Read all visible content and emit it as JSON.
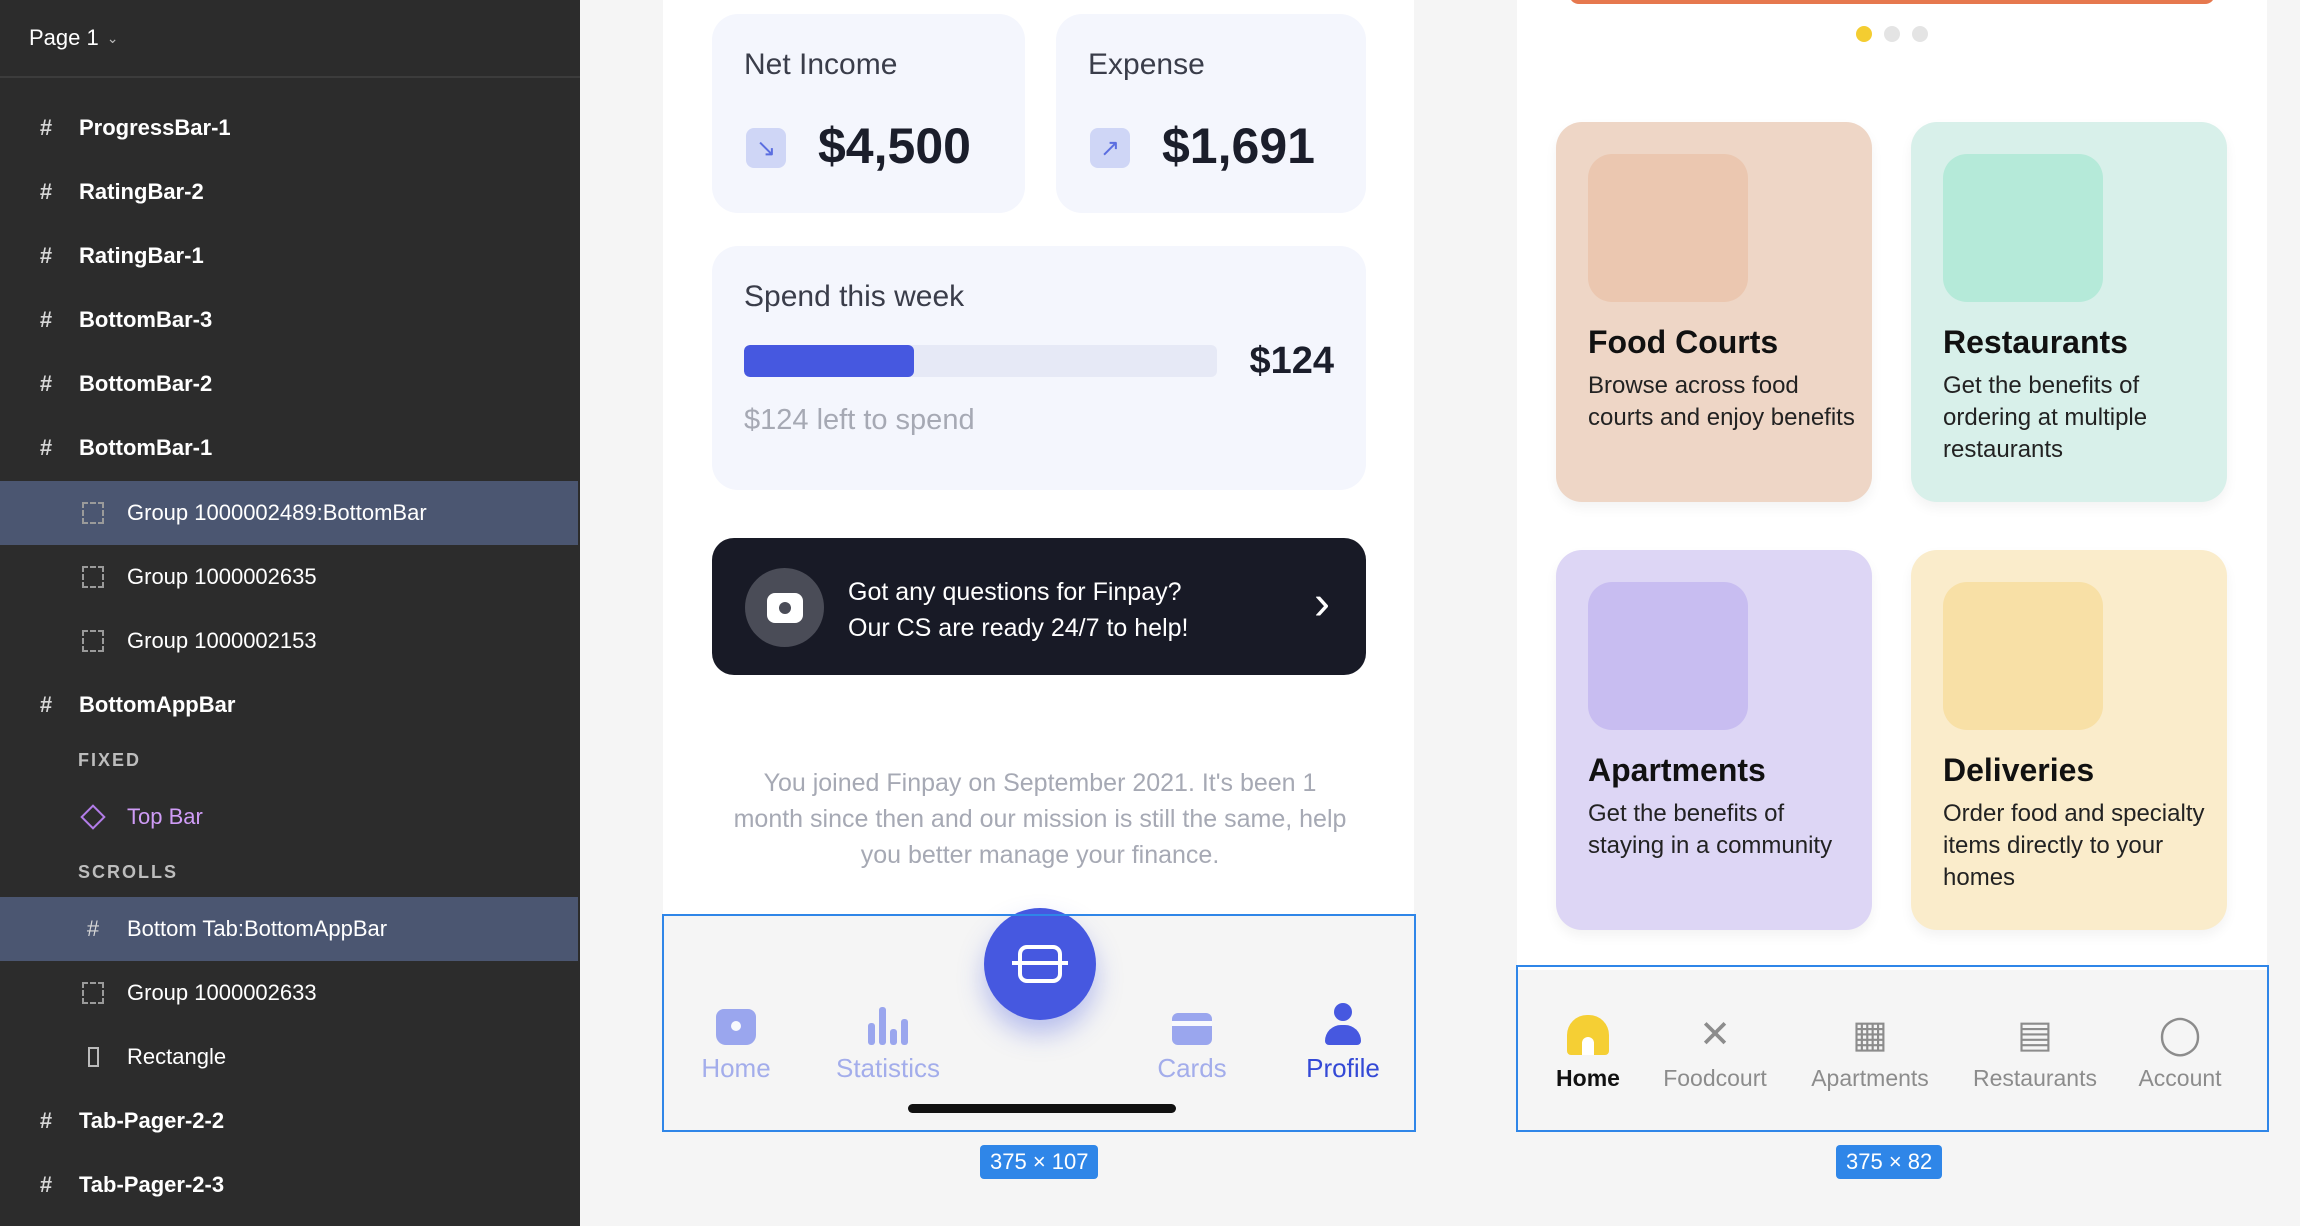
{
  "layers_panel": {
    "page_name": "Page 1",
    "fixed_label": "FIXED",
    "scrolls_label": "SCROLLS",
    "items": [
      {
        "label": "ProgressBar-1"
      },
      {
        "label": "RatingBar-2"
      },
      {
        "label": "RatingBar-1"
      },
      {
        "label": "BottomBar-3"
      },
      {
        "label": "BottomBar-2"
      },
      {
        "label": "BottomBar-1"
      },
      {
        "label": "Group 1000002489:BottomBar"
      },
      {
        "label": "Group 1000002635"
      },
      {
        "label": "Group 1000002153"
      },
      {
        "label": "BottomAppBar"
      },
      {
        "label": "Top Bar"
      },
      {
        "label": "Bottom Tab:BottomAppBar"
      },
      {
        "label": "Group 1000002633"
      },
      {
        "label": "Rectangle"
      },
      {
        "label": "Tab-Pager-2-2"
      },
      {
        "label": "Tab-Pager-2-3"
      }
    ]
  },
  "finpay": {
    "net_income": {
      "label": "Net Income",
      "amount": "$4,500"
    },
    "expense": {
      "label": "Expense",
      "amount": "$1,691"
    },
    "spend": {
      "title": "Spend this week",
      "amount": "$124",
      "left_text": "$124 left to spend",
      "progress_percent": 36
    },
    "cs_banner": {
      "line1": "Got any questions for Finpay?",
      "line2": "Our CS are ready 24/7 to help!"
    },
    "joined_text": "You joined Finpay on September 2021. It's been 1 month since then and our mission is still the same, help you better manage your finance.",
    "tabs": [
      {
        "label": "Home",
        "icon": "home-icon"
      },
      {
        "label": "Statistics",
        "icon": "statistics-icon"
      },
      {
        "label": "Cards",
        "icon": "card-icon"
      },
      {
        "label": "Profile",
        "icon": "profile-icon",
        "active": true
      }
    ],
    "size_tag": "375 × 107"
  },
  "food_app": {
    "tiles": [
      {
        "title": "Food Courts",
        "desc": "Browse across food courts and enjoy benefits",
        "bg": "#eed6c6",
        "accent": "#ebc7b0"
      },
      {
        "title": "Restaurants",
        "desc": "Get the benefits of ordering at multiple restaurants",
        "bg": "#d8f0ea",
        "accent": "#b5ead9"
      },
      {
        "title": "Apartments",
        "desc": "Get the benefits of staying in a community",
        "bg": "#ddd6f5",
        "accent": "#c8bdf1"
      },
      {
        "title": "Deliveries",
        "desc": "Order food and specialty items directly to your homes",
        "bg": "#faeccb",
        "accent": "#f8e0a6"
      }
    ],
    "tabs": [
      {
        "label": "Home",
        "icon": "home-icon",
        "active": true
      },
      {
        "label": "Foodcourt",
        "icon": "fork-knife-icon"
      },
      {
        "label": "Apartments",
        "icon": "building-icon"
      },
      {
        "label": "Restaurants",
        "icon": "restaurant-icon"
      },
      {
        "label": "Account",
        "icon": "account-icon"
      }
    ],
    "size_tag": "375 × 82"
  },
  "colors": {
    "accent": "#4658e0",
    "selection": "#2f86e8",
    "food_active": "#f5cf34"
  }
}
